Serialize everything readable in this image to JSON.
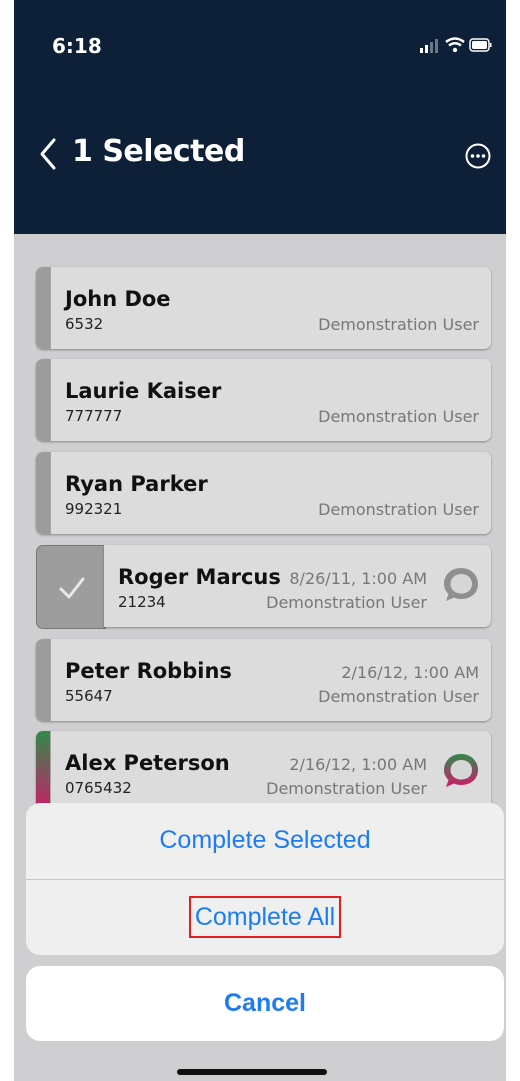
{
  "status_bar": {
    "time": "6:18"
  },
  "nav": {
    "title": "1 Selected"
  },
  "items": [
    {
      "name": "John Doe",
      "number": "6532",
      "user": "Demonstration User",
      "date": ""
    },
    {
      "name": "Laurie Kaiser",
      "number": "777777",
      "user": "Demonstration User",
      "date": ""
    },
    {
      "name": "Ryan Parker",
      "number": "992321",
      "user": "Demonstration User",
      "date": ""
    },
    {
      "name": "Roger Marcus",
      "number": "21234",
      "user": "Demonstration User",
      "date": "8/26/11, 1:00 AM",
      "selected": true
    },
    {
      "name": "Peter Robbins",
      "number": "55647",
      "user": "Demonstration User",
      "date": "2/16/12, 1:00 AM"
    },
    {
      "name": "Alex Peterson",
      "number": "0765432",
      "user": "Demonstration User",
      "date": "2/16/12, 1:00 AM"
    }
  ],
  "action_sheet": {
    "complete_selected": "Complete Selected",
    "complete_all": "Complete All",
    "cancel": "Cancel"
  },
  "colors": {
    "header": "#0e1f38",
    "accent": "#1e7cf2",
    "highlight_border": "#e02020",
    "gradient_start": "#2f8a4a",
    "gradient_end": "#d11a6a"
  }
}
